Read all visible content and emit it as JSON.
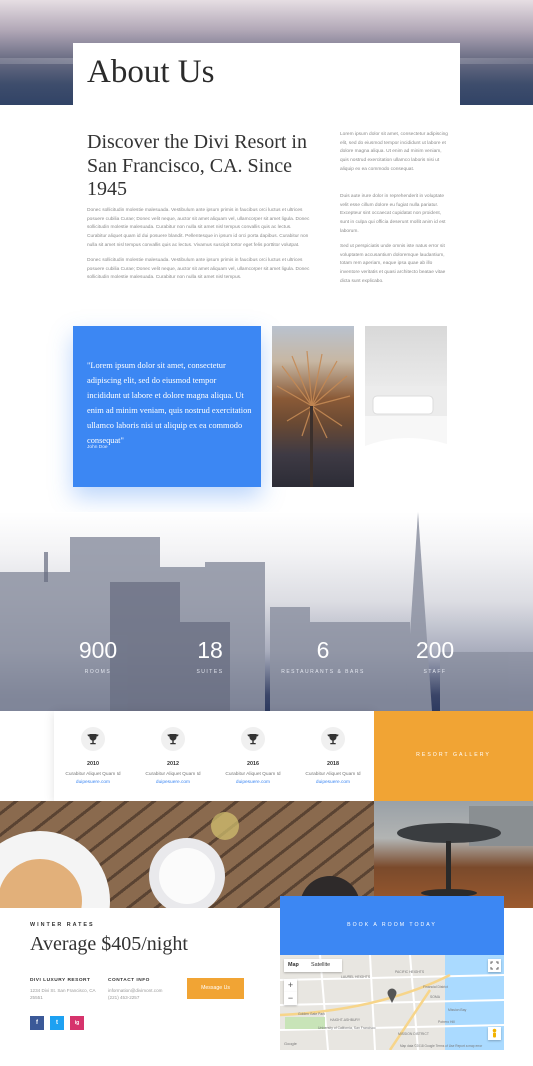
{
  "hero": {
    "title": "About Us"
  },
  "intro": {
    "heading": "Discover the Divi Resort in San Francisco, CA. Since 1945",
    "paragraph_1": "Donec sollicitudin molestie malesuada. Vestibulum ante ipsum primis in faucibus orci luctus et ultrices posuere cubilia Curae; Donec velit neque, auctor sit amet aliquam vel, ullamcorper sit amet ligula. Donec sollicitudin molestie malesuada. Curabitur non nulla sit amet nisl tempus convallis quis ac lectus. Curabitur aliquet quam id dui posuere blandit. Pellentesque in ipsum id orci porta dapibus. Curabitur non nulla sit amet nisl tempus convallis quis ac lectus. Vivamus suscipit tortor eget felis porttitor volutpat.",
    "paragraph_2": "Donec sollicitudin molestie malesuada. Vestibulum ante ipsum primis in faucibus orci luctus et ultrices posuere cubilia Curae; Donec velit neque, auctor sit amet aliquam vel, ullamcorper sit amet ligula. Donec sollicitudin molestie malesuada. Curabitur non nulla sit amet nisl tempus.",
    "right_1": "Lorem ipsum dolor sit amet, consectetur adipiscing elit, sed do eiusmod tempor incididunt ut labore et dolore magna aliqua. Ut enim ad minim veniam, quis nostrud exercitation ullamco laboris nisi ut aliquip ex ea commodo consequat.",
    "right_2": "Duis aute irure dolor in reprehenderit in voluptate velit esse cillum dolore eu fugiat nulla pariatur. Excepteur sint occaecat cupidatat non proident, sunt in culpa qui officia deserunt mollit anim id est laborum.",
    "right_3": "Sed ut perspiciatis unde omnis iste natus error sit voluptatem accusantium doloremque laudantium, totam rem aperiam, eaque ipsa quae ab illo inventore veritatis et quasi architecto beatae vitae dicta sunt explicabo."
  },
  "quote": {
    "text": "\"Lorem ipsum dolor sit amet, consectetur adipiscing elit, sed do eiusmod tempor incididunt ut labore et dolore magna aliqua. Ut enim ad minim veniam, quis nostrud exercitation ullamco laboris nisi ut aliquip ex ea commodo consequat\"",
    "author": "John Doe"
  },
  "stats": [
    {
      "number": "900",
      "label": "ROOMS"
    },
    {
      "number": "18",
      "label": "SUITES"
    },
    {
      "number": "6",
      "label": "RESTAURANTS & BARS"
    },
    {
      "number": "200",
      "label": "STAFF"
    }
  ],
  "awards": [
    {
      "year": "2010",
      "text": "Curabitur Aliquet Quam Id",
      "link": "duipesuere.com",
      "icon": "trophy-icon"
    },
    {
      "year": "2012",
      "text": "Curabitur Aliquet Quam Id",
      "link": "duipesuere.com",
      "icon": "trophy-icon"
    },
    {
      "year": "2016",
      "text": "Curabitur Aliquet Quam Id",
      "link": "duipesuere.com",
      "icon": "trophy-icon"
    },
    {
      "year": "2018",
      "text": "Curabitur Aliquet Quam Id",
      "link": "duipesuere.com",
      "icon": "trophy-icon"
    }
  ],
  "gallery": {
    "label": "RESORT GALLERY"
  },
  "footer": {
    "rates_label": "WINTER RATES",
    "rates_price": "Average $405/night",
    "resort_head": "DIVI LUXURY RESORT",
    "resort_line_1": "1234 Divi St. San Francisco, CA",
    "resort_line_2": "25551",
    "contact_head": "CONTACT INFO",
    "contact_line_1": "information@divimont.com",
    "contact_line_2": "(221) 453-2257",
    "message_button": "Message Us",
    "social": {
      "facebook": "f",
      "twitter": "t",
      "instagram": "ig"
    }
  },
  "booking": {
    "label": "BOOK A ROOM TODAY"
  },
  "map": {
    "tab_map": "Map",
    "tab_satellite": "Satellite",
    "zoom_in": "+",
    "zoom_out": "−",
    "labels": [
      "LAUREL HEIGHTS",
      "PACIFIC HEIGHTS",
      "Financial District",
      "SOMA",
      "Mission Bay",
      "Potrero Hill",
      "Golden Gate Park",
      "MISSION DISTRICT",
      "HAIGHT-ASHBURY",
      "University of California, San Francisco"
    ],
    "attribution": "Map data ©2018 Google   Terms of Use   Report a map error",
    "logo": "Google"
  },
  "colors": {
    "accent_blue": "#3c87f3",
    "accent_orange": "#f1a434"
  }
}
